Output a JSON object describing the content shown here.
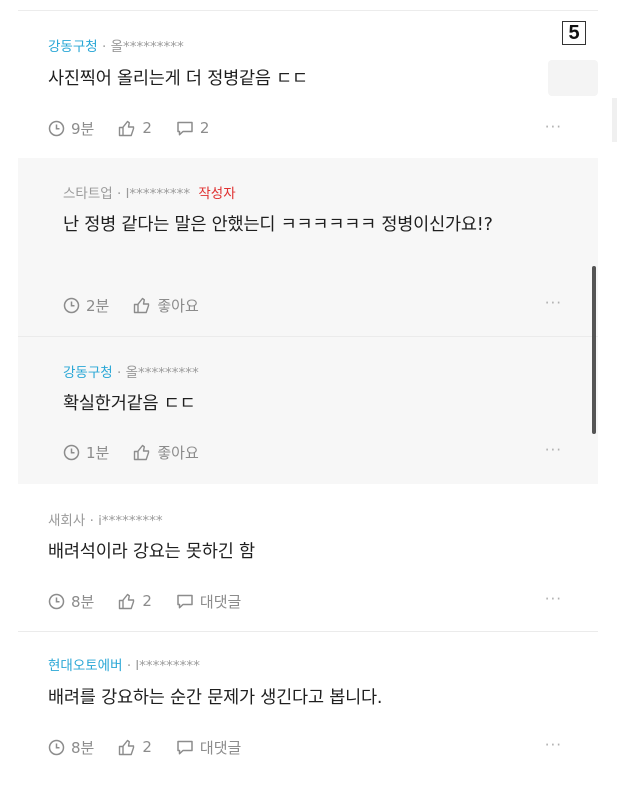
{
  "page_badge": "5",
  "comments": [
    {
      "author": "강동구청",
      "author_id": "· 올*********",
      "is_op": false,
      "body": "사진찍어 올리는게 더 정병같음 ㄷㄷ",
      "time": "9분",
      "likes": "2",
      "replies": "2"
    },
    {
      "author": "스타트업",
      "author_id": "· l*********",
      "op_label": "작성자",
      "body": "난 정병 같다는 말은 안했는디 ㅋㅋㅋㅋㅋㅋ 정병이신가요!?",
      "time": "2분",
      "likes": "좋아요"
    },
    {
      "author": "강동구청",
      "author_id": "· 올*********",
      "body": "확실한거같음 ㄷㄷ",
      "time": "1분",
      "likes": "좋아요"
    },
    {
      "author": "새회사",
      "author_id": "· i*********",
      "body": "배려석이라 강요는 못하긴 함",
      "time": "8분",
      "likes": "2",
      "replies": "대댓글"
    },
    {
      "author": "현대오토에버",
      "author_id": "· l*********",
      "body": "배려를 강요하는 순간 문제가 생긴다고 봅니다.",
      "time": "8분",
      "likes": "2",
      "replies": "대댓글"
    }
  ],
  "more_label": "···",
  "colors": {
    "author_blue": "#2aa7d6",
    "op_red": "#e03131",
    "reply_bg": "#f7f7f7"
  }
}
